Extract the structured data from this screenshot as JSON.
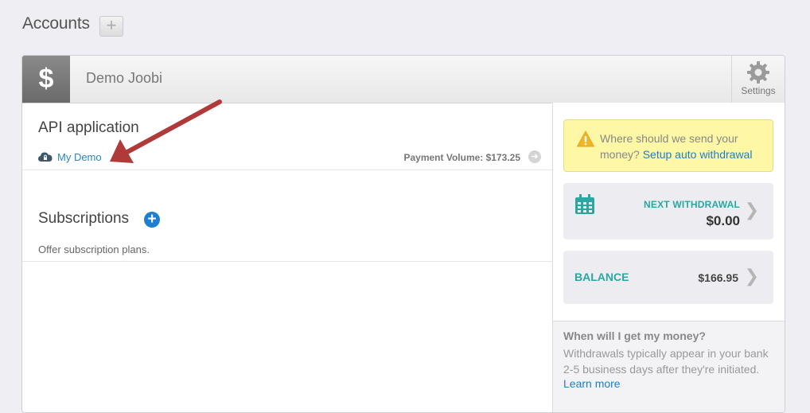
{
  "page": {
    "title": "Accounts",
    "add_symbol": "+"
  },
  "account": {
    "name": "Demo Joobi",
    "symbol": "$",
    "settings_label": "Settings"
  },
  "api_section": {
    "title": "API application",
    "app_name": "My Demo",
    "payment_volume": "Payment Volume: $173.25"
  },
  "subscriptions": {
    "title": "Subscriptions",
    "description": "Offer subscription plans.",
    "add_symbol": "+"
  },
  "withdrawal_alert": {
    "text": "Where should we send your money?",
    "link": "Setup auto withdrawal"
  },
  "next_withdrawal": {
    "label": "NEXT WITHDRAWAL",
    "amount": "$0.00"
  },
  "balance": {
    "label": "BALANCE",
    "amount": "$166.95"
  },
  "info": {
    "title": "When will I get my money?",
    "body": "Withdrawals typically appear in your bank 2-5 business days after they're initiated.",
    "link": "Learn more"
  },
  "colors": {
    "link_blue": "#2a86c6",
    "teal": "#2aa7a3",
    "alert_yellow": "#fdf7a6",
    "annotation_red": "#b03a3a"
  }
}
